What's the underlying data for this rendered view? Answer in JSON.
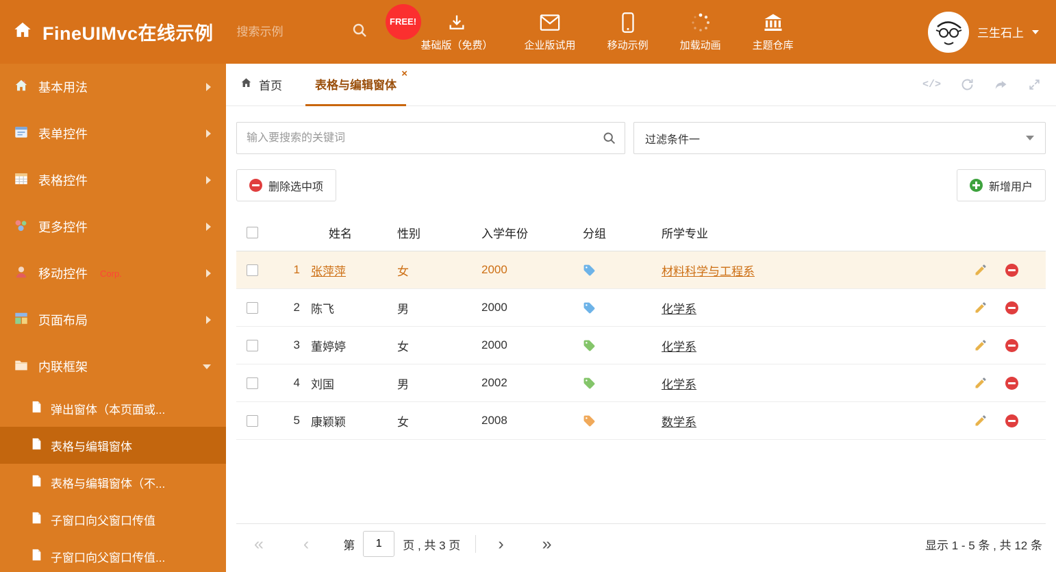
{
  "header": {
    "title": "FineUIMvc在线示例",
    "search_placeholder": "搜索示例",
    "free_badge": "FREE!",
    "nav": [
      {
        "label": "基础版（免费）",
        "icon": "download-icon"
      },
      {
        "label": "企业版试用",
        "icon": "envelope-icon"
      },
      {
        "label": "移动示例",
        "icon": "mobile-icon"
      },
      {
        "label": "加载动画",
        "icon": "spinner-icon"
      },
      {
        "label": "主题仓库",
        "icon": "bank-icon"
      }
    ],
    "user": "三生石上"
  },
  "sidebar": {
    "items": [
      {
        "label": "基本用法",
        "icon": "home-icon"
      },
      {
        "label": "表单控件",
        "icon": "form-icon"
      },
      {
        "label": "表格控件",
        "icon": "table-icon"
      },
      {
        "label": "更多控件",
        "icon": "widgets-icon"
      },
      {
        "label": "移动控件",
        "badge": "Corp.",
        "icon": "mobile-person-icon"
      },
      {
        "label": "页面布局",
        "icon": "layout-icon"
      },
      {
        "label": "内联框架",
        "icon": "folder-icon",
        "expanded": true
      }
    ],
    "subitems": [
      {
        "label": "弹出窗体（本页面或..."
      },
      {
        "label": "表格与编辑窗体",
        "active": true
      },
      {
        "label": "表格与编辑窗体（不..."
      },
      {
        "label": "子窗口向父窗口传值"
      },
      {
        "label": "子窗口向父窗口传值..."
      }
    ]
  },
  "tabs": {
    "home_label": "首页",
    "active_label": "表格与编辑窗体",
    "close_glyph": "×",
    "code_glyph": "</>"
  },
  "filters": {
    "search_placeholder": "输入要搜索的关键词",
    "filter_value": "过滤条件一"
  },
  "toolbar": {
    "delete_label": "删除选中项",
    "add_label": "新增用户"
  },
  "table": {
    "headers": [
      "姓名",
      "性别",
      "入学年份",
      "分组",
      "所学专业"
    ],
    "rows": [
      {
        "num": "1",
        "name": "张萍萍",
        "gender": "女",
        "year": "2000",
        "tag_color": "#6db3e8",
        "major": "材料科学与工程系",
        "selected": true
      },
      {
        "num": "2",
        "name": "陈飞",
        "gender": "男",
        "year": "2000",
        "tag_color": "#6db3e8",
        "major": "化学系"
      },
      {
        "num": "3",
        "name": "董婷婷",
        "gender": "女",
        "year": "2000",
        "tag_color": "#84c56a",
        "major": "化学系"
      },
      {
        "num": "4",
        "name": "刘国",
        "gender": "男",
        "year": "2002",
        "tag_color": "#84c56a",
        "major": "化学系"
      },
      {
        "num": "5",
        "name": "康颖颖",
        "gender": "女",
        "year": "2008",
        "tag_color": "#f0a95a",
        "major": "数学系"
      }
    ]
  },
  "pagination": {
    "first_glyph": "«",
    "prev_glyph": "‹",
    "next_glyph": "›",
    "last_glyph": "»",
    "page_prefix": "第",
    "current_page": "1",
    "page_suffix": "页 , 共 3 页",
    "summary": "显示 1 - 5 条 , 共 12 条"
  },
  "colors": {
    "header_bg": "#d8721a",
    "sidebar_bg": "#dc7c22",
    "sidebar_active_bg": "#c3660e",
    "accent": "#c9660d",
    "selected_row_bg": "#fcf4e6",
    "selected_row_text": "#cd6f14",
    "free_badge_bg": "#fb2f2f",
    "delete_icon": "#e03e3e",
    "add_icon": "#3da23d"
  }
}
